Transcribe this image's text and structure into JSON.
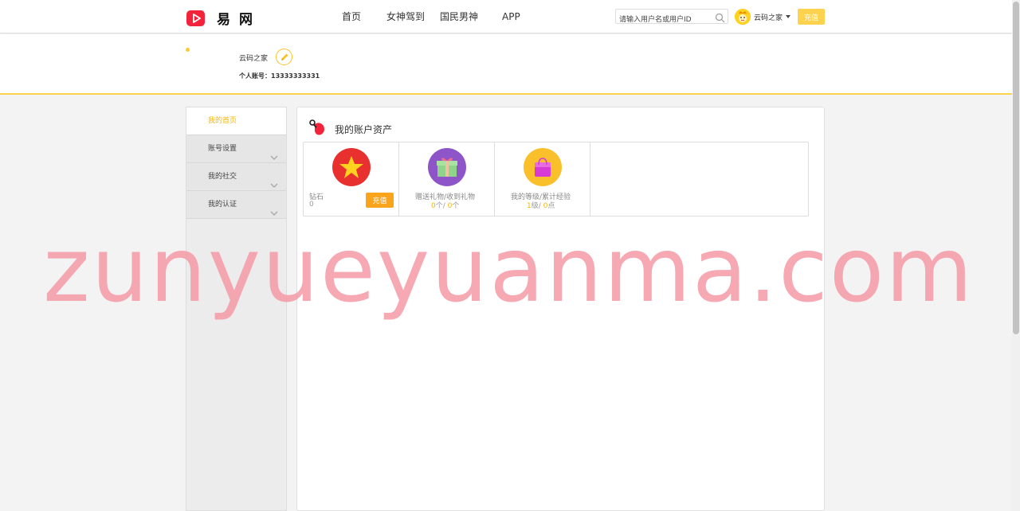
{
  "brand": {
    "name": "易网",
    "accent": "#fdd24e",
    "logo_color": "#f2233b"
  },
  "nav": {
    "items": [
      "首页",
      "女神驾到",
      "国民男神",
      "APP"
    ]
  },
  "search": {
    "placeholder": "请输入用户名或用户ID"
  },
  "user": {
    "name": "云码之家"
  },
  "top_recharge_label": "充值",
  "profile": {
    "name": "云码之家",
    "account_label": "个人账号：13333333331"
  },
  "sidebar": {
    "items": [
      {
        "label": "我的首页",
        "active": true
      },
      {
        "label": "账号设置"
      },
      {
        "label": "我的社交"
      },
      {
        "label": "我的认证"
      }
    ]
  },
  "main": {
    "title": "我的账户资产",
    "diamond": {
      "label": "钻石",
      "value": "0",
      "button": "充值"
    },
    "gifts": {
      "label": "赠送礼物/收到礼物",
      "sent": "0",
      "sent_unit": "个/ ",
      "received": "0",
      "received_unit": "个"
    },
    "level": {
      "label": "我的等级/累计经验",
      "level": "1",
      "level_unit": "级/ ",
      "exp": "0",
      "exp_unit": "点"
    }
  },
  "watermark": "zunyueyuanma.com",
  "icons": [
    "logo-play-icon",
    "search-icon",
    "avatar-icon",
    "edit-pencil-icon",
    "chevron-down-icon",
    "assets-bag-icon",
    "star-icon",
    "gift-icon",
    "shopping-bag-icon"
  ]
}
